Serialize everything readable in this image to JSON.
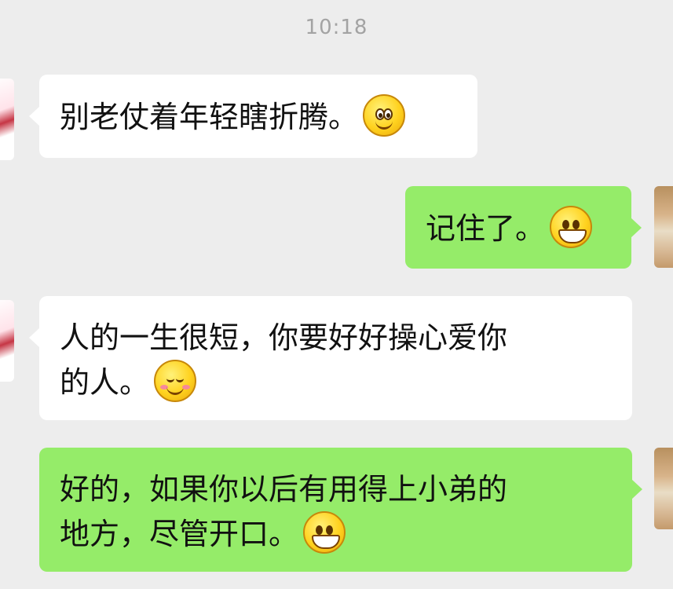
{
  "status": {
    "time": "10:18"
  },
  "messages": [
    {
      "side": "left",
      "text": "别老仗着年轻瞎折腾。",
      "emoji": "smile-wide-eyes"
    },
    {
      "side": "right",
      "text": "记住了。",
      "emoji": "grin-teeth"
    },
    {
      "side": "left",
      "line1": "人的一生很短，你要好好操心爱你",
      "line2": "的人。",
      "emoji": "blushing-smile"
    },
    {
      "side": "right",
      "line1": "好的，如果你以后有用得上小弟的",
      "line2": "地方，尽管开口。",
      "emoji": "big-grin"
    }
  ],
  "colors": {
    "background": "#ededed",
    "incoming_bubble": "#ffffff",
    "outgoing_bubble": "#95ec69",
    "timestamp": "#a3a3a3"
  }
}
